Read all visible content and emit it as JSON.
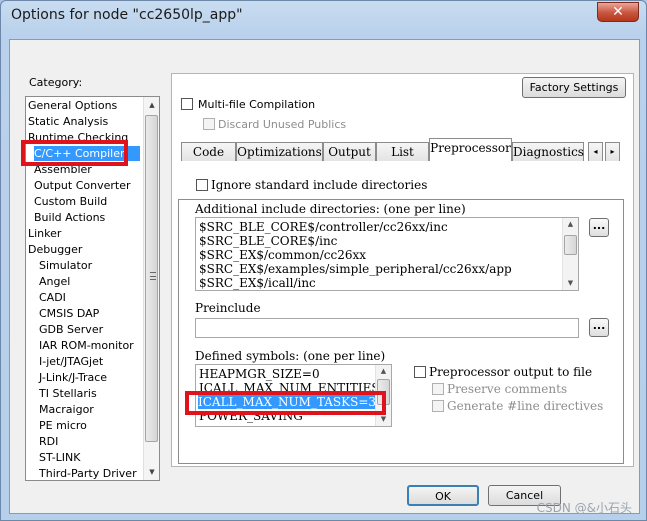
{
  "window": {
    "title": "Options for node \"cc2650lp_app\"",
    "close_glyph": "✕"
  },
  "category": {
    "label": "Category:",
    "items": [
      "General Options",
      "Static Analysis",
      "Runtime Checking",
      "C/C++ Compiler",
      "Assembler",
      "Output Converter",
      "Custom Build",
      "Build Actions",
      "Linker",
      "Debugger",
      "Simulator",
      "Angel",
      "CADI",
      "CMSIS DAP",
      "GDB Server",
      "IAR ROM-monitor",
      "I-jet/JTAGjet",
      "J-Link/J-Trace",
      "TI Stellaris",
      "Macraigor",
      "PE micro",
      "RDI",
      "ST-LINK",
      "Third-Party Driver"
    ],
    "selected": "C/C++ Compiler"
  },
  "top": {
    "factory_settings": "Factory Settings",
    "multi_file": "Multi-file Compilation",
    "discard_unused": "Discard Unused Publics"
  },
  "tabs": [
    "Code",
    "Optimizations",
    "Output",
    "List",
    "Preprocessor",
    "Diagnostics"
  ],
  "active_tab": "Preprocessor",
  "tab_nav": {
    "left": "◂",
    "right": "▸"
  },
  "preprocessor": {
    "ignore_std": "Ignore standard include directories",
    "include_label": "Additional include directories: (one per line)",
    "include_dirs": [
      "$SRC_BLE_CORE$/controller/cc26xx/inc",
      "$SRC_BLE_CORE$/inc",
      "$SRC_EX$/common/cc26xx",
      "$SRC_EX$/examples/simple_peripheral/cc26xx/app",
      "$SRC_EX$/icall/inc"
    ],
    "preinclude_label": "Preinclude",
    "preinclude_value": "",
    "defined_label": "Defined symbols: (one per line)",
    "defined_symbols": [
      "HEAPMGR_SIZE=0",
      "ICALL_MAX_NUM_ENTITIES",
      "ICALL_MAX_NUM_TASKS=3",
      "POWER_SAVING"
    ],
    "selected_symbol": "ICALL_MAX_NUM_TASKS=3",
    "pp_output": "Preprocessor output to file",
    "preserve_comments": "Preserve comments",
    "generate_line": "Generate #line directives",
    "browse": "..."
  },
  "footer": {
    "ok": "OK",
    "cancel": "Cancel"
  },
  "watermark": "CSDN @&小石头",
  "colors": {
    "selection": "#3399ff",
    "highlight_box": "#e0121b"
  }
}
